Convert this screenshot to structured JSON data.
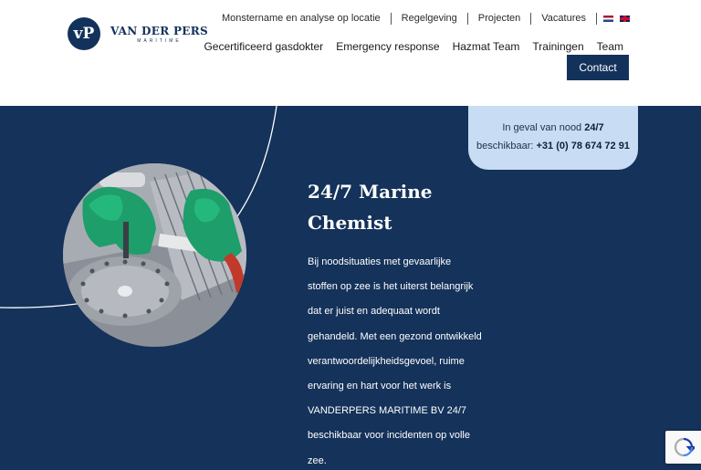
{
  "logo": {
    "initials": "vP",
    "name": "VAN DER PERS",
    "tagline": "MARITIME"
  },
  "topnav": [
    "Monstername en analyse op locatie",
    "Regelgeving",
    "Projecten",
    "Vacatures"
  ],
  "mainnav": [
    "Gecertificeerd gasdokter",
    "Emergency response",
    "Hazmat Team",
    "Trainingen",
    "Team"
  ],
  "contact_label": "Contact",
  "emergency": {
    "text1": "In geval van nood ",
    "bold1": "24/7",
    "text2": "beschikbaar: ",
    "phone": "+31 (0) 78 674 72 91"
  },
  "hero": {
    "title_line1": "24/7 Marine",
    "title_line2": "Chemist",
    "body_lines": [
      "Bij noodsituaties met gevaarlijke",
      "stoffen op zee is het uiterst belangrijk",
      "dat er juist en adequaat wordt",
      "gehandeld. Met een gezond ontwikkeld",
      "verantwoordelijkheidsgevoel, ruime",
      "ervaring en hart voor het werk is",
      "VANDERPERS MARITIME BV 24/7",
      "beschikbaar voor incidenten op volle",
      "zee."
    ]
  },
  "colors": {
    "navy": "#14325a",
    "button": "#13325b",
    "emergency_bg": "#c8ddf3",
    "suit_green": "#1e9e6a"
  },
  "icons": {
    "nl_flag": "flag-nl-icon",
    "en_flag": "flag-en-icon",
    "recaptcha": "recaptcha-icon"
  }
}
